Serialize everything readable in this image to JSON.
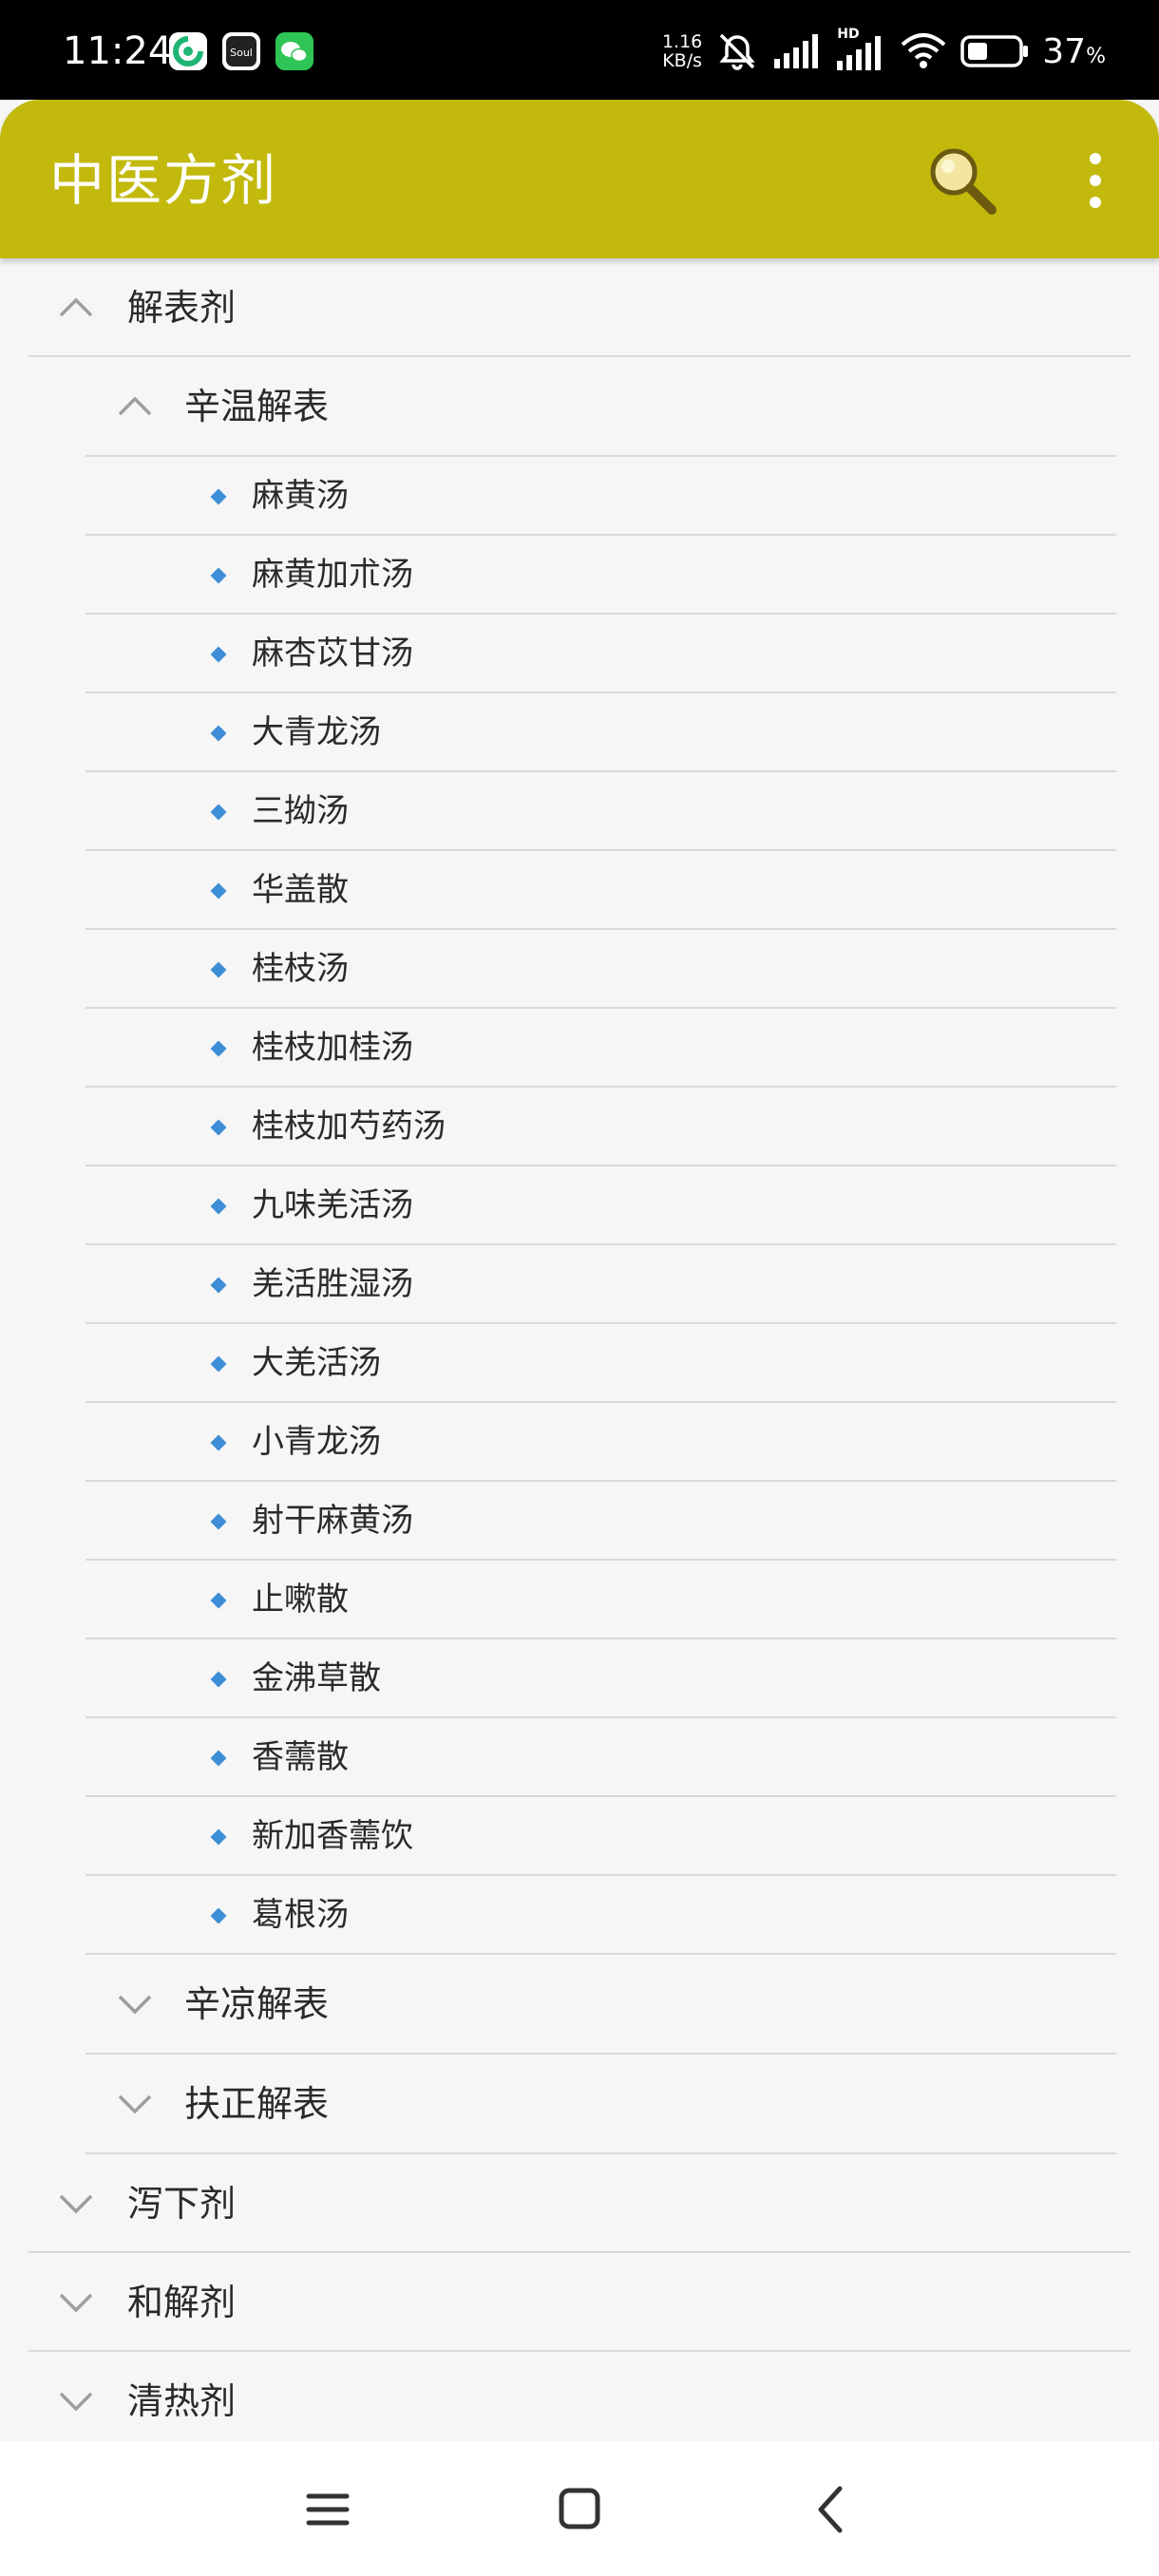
{
  "status_bar": {
    "time": "11:24",
    "notification_icons": [
      "app-notification-icon",
      "soul-app-icon",
      "wechat-icon"
    ],
    "net_speed_value": "1.16",
    "net_speed_unit": "KB/s",
    "hd_label": "HD",
    "battery_percent": "37",
    "battery_symbol": "%"
  },
  "app_bar": {
    "title": "中医方剂",
    "background_color": "#c2b90c",
    "search_icon": "search-icon",
    "menu_icon": "more-vert-icon"
  },
  "tree": {
    "groups": [
      {
        "label": "解表剂",
        "expanded": true,
        "subgroups": [
          {
            "label": "辛温解表",
            "expanded": true,
            "items": [
              "麻黄汤",
              "麻黄加朮汤",
              "麻杏苡甘汤",
              "大青龙汤",
              "三拗汤",
              "华盖散",
              "桂枝汤",
              "桂枝加桂汤",
              "桂枝加芍药汤",
              "九味羌活汤",
              "羌活胜湿汤",
              "大羌活汤",
              "小青龙汤",
              "射干麻黄汤",
              "止嗽散",
              "金沸草散",
              "香薷散",
              "新加香薷饮",
              "葛根汤"
            ]
          },
          {
            "label": "辛凉解表",
            "expanded": false
          },
          {
            "label": "扶正解表",
            "expanded": false
          }
        ]
      },
      {
        "label": "泻下剂",
        "expanded": false
      },
      {
        "label": "和解剂",
        "expanded": false
      },
      {
        "label": "清热剂",
        "expanded": false
      }
    ]
  },
  "nav_bar": {
    "buttons": [
      "menu-icon",
      "home-icon",
      "back-icon"
    ]
  }
}
